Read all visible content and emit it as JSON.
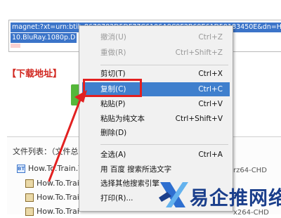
{
  "magnet": {
    "line1": "magnet:?xt=urn:btih:8678782D5DF77C6106A8C9F2B69E61D59183450E&dn=How",
    "line2": "10.BluRay.1080p.D"
  },
  "download": {
    "title": "【下载地址】"
  },
  "files": {
    "list_label": "文件列表：（文件总大",
    "rows": [
      {
        "name": "How.To.Train.Y",
        "icon": "bt-icon"
      },
      {
        "name": "How.To.Trai",
        "icon": "film-icon"
      },
      {
        "name": "How.To.Trai",
        "icon": "film-icon"
      },
      {
        "name": "How.To.Trai",
        "icon": "film-icon"
      }
    ],
    "right_fragments": {
      "r1": "rz64-CHD",
      "r2": "x264-CHD"
    }
  },
  "menu": {
    "items": [
      {
        "label": "撤消(U)",
        "shortcut": "Ctrl+Z",
        "state": "disabled"
      },
      {
        "label": "重做(R)",
        "shortcut": "Ctrl+Shift+Z",
        "state": "disabled"
      },
      {
        "label": "剪切(T)",
        "shortcut": "Ctrl+X",
        "state": "normal"
      },
      {
        "label": "复制(C)",
        "shortcut": "Ctrl+C",
        "state": "hover"
      },
      {
        "label": "粘贴(P)",
        "shortcut": "Ctrl+V",
        "state": "normal"
      },
      {
        "label": "粘贴为纯文本",
        "shortcut": "Ctrl+Shift+V",
        "state": "normal"
      },
      {
        "label": "删除(D)",
        "shortcut": "",
        "state": "normal"
      },
      {
        "label": "全选(A)",
        "shortcut": "Ctrl+A",
        "state": "normal"
      },
      {
        "label": "用 百度 搜索所选文字",
        "shortcut": "",
        "state": "normal"
      },
      {
        "label": "选择其他搜索引擎",
        "shortcut": "",
        "state": "normal"
      },
      {
        "label": "打印(R)...",
        "shortcut": "",
        "state": "normal"
      }
    ]
  },
  "watermark": {
    "text": "易企推网络",
    "icon": "logo-x-icon"
  },
  "colors": {
    "menu_highlight": "#3f7fcd",
    "annotation_red": "#e22020",
    "logo_blue": "#1a3e8b",
    "selection_blue": "#3b74c9"
  }
}
